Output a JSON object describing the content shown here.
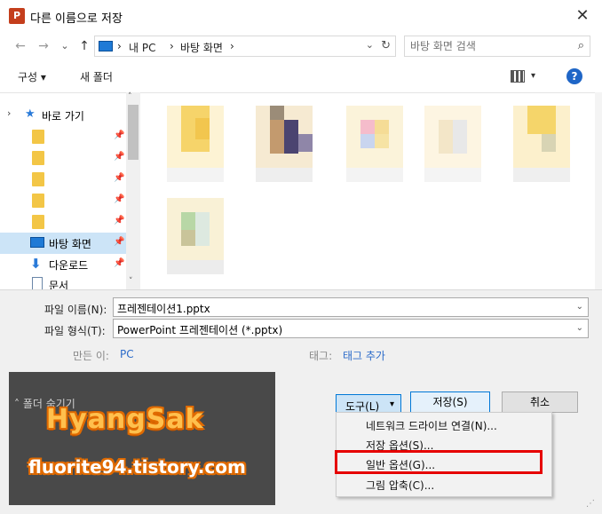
{
  "window": {
    "app_icon": "P",
    "title": "다른 이름으로 저장",
    "close_glyph": "✕"
  },
  "addressbar": {
    "back": "←",
    "forward": "→",
    "recent": "⌄",
    "up": "↑",
    "crumbs": [
      "내 PC",
      "바탕 화면"
    ],
    "separator": "›",
    "dropdown": "⌄",
    "refresh": "↻"
  },
  "search": {
    "placeholder": "바탕 화면 검색",
    "icon": "⌕"
  },
  "toolbar": {
    "organize": "구성 ▾",
    "new_folder": "새 폴더",
    "view_drop": "▾",
    "help": "?"
  },
  "navpane": {
    "quick_access": "바로 가기",
    "pin": "📌",
    "desktop": "바탕 화면",
    "downloads": "다운로드",
    "documents": "문서",
    "up_arrow": "˄",
    "down_arrow": "˅"
  },
  "form": {
    "filename_label": "파일 이름(N):",
    "filename_value": "프레젠테이션1.pptx",
    "filetype_label": "파일 형식(T):",
    "filetype_value": "PowerPoint 프레젠테이션 (*.pptx)",
    "dropdown_arrow": "⌄",
    "author_label": "만든 이:",
    "author_value": "PC",
    "tags_label": "태그:",
    "tags_value": "태그 추가",
    "hide_folders": "폴더 숨기기",
    "hide_chevron": "˄"
  },
  "buttons": {
    "tools": "도구(L)",
    "tools_arrow": "▾",
    "save": "저장(S)",
    "cancel": "취소"
  },
  "tools_menu": {
    "items": [
      "네트워크 드라이브 연결(N)...",
      "저장 옵션(S)...",
      "일반 옵션(G)...",
      "그림 압축(C)..."
    ]
  },
  "watermark": {
    "title": "HyangSak",
    "url": "fluorite94.tistory.com"
  },
  "colors": {
    "accent": "#0078d7",
    "highlight_box": "#e60000",
    "selected_nav": "#cce4f7"
  }
}
